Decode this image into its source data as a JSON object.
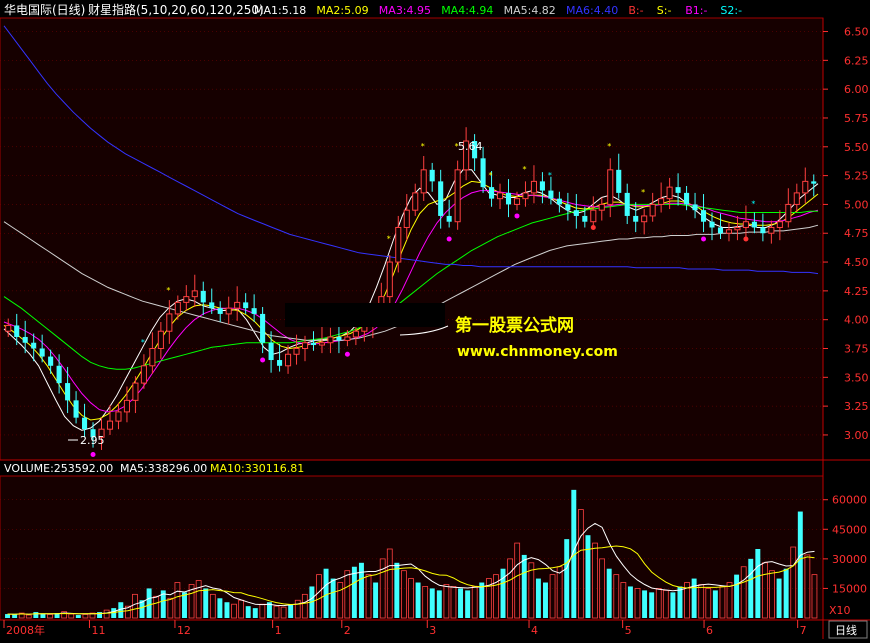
{
  "header": {
    "title": "华电国际(日线)",
    "indicator": "财星指路(5,10,20,60,120,250)",
    "ma_items": [
      {
        "label": "MA1:5.18",
        "color": "#ffffff"
      },
      {
        "label": "MA2:5.09",
        "color": "#ffff00"
      },
      {
        "label": "MA3:4.95",
        "color": "#ff00ff"
      },
      {
        "label": "MA4:4.94",
        "color": "#00ff00"
      },
      {
        "label": "MA5:4.82",
        "color": "#d0d0d0"
      },
      {
        "label": "MA6:4.40",
        "color": "#3333ff"
      },
      {
        "label": "B:-",
        "color": "#ff3333"
      },
      {
        "label": "S:-",
        "color": "#ffff00"
      },
      {
        "label": "B1:-",
        "color": "#ff00ff"
      },
      {
        "label": "S2:-",
        "color": "#00ffff"
      }
    ]
  },
  "volume_header": {
    "volume": "VOLUME:253592.00",
    "ma5": "MA5:338296.00",
    "ma10": "MA10:330116.81"
  },
  "watermark": {
    "title": "第一股票公式网",
    "url": "www.chnmoney.com"
  },
  "price_annotations": {
    "high": "5.64",
    "low": "2.95"
  },
  "x_axis": {
    "labels": [
      "2008年",
      "11",
      "12",
      "1",
      "2",
      "3",
      "4",
      "5",
      "6",
      "7"
    ],
    "period_button": "日线"
  },
  "volume_unit": "X10",
  "colors": {
    "background": "#000000",
    "panel_bg": "#1a0000",
    "grid": "#800000",
    "up": "#ff4040",
    "down": "#40ffff",
    "axis_text": "#ff3030"
  },
  "chart_data": [
    {
      "type": "candlestick",
      "title": "华电国际(日线)",
      "ylim": [
        2.8,
        6.6
      ],
      "yticks": [
        3.0,
        3.25,
        3.5,
        3.75,
        4.0,
        4.25,
        4.5,
        4.75,
        5.0,
        5.25,
        5.5,
        5.75,
        6.0,
        6.25,
        6.5
      ],
      "ytick_labels": [
        "3.00",
        "3.25",
        "3.50",
        "3.75",
        "4.00",
        "4.25",
        "4.50",
        "4.75",
        "5.00",
        "5.25",
        "5.50",
        "5.75",
        "6.00",
        "6.25",
        "6.50"
      ],
      "month_labels": [
        "2008年",
        "11",
        "12",
        "1",
        "2",
        "3",
        "4",
        "5",
        "6",
        "7"
      ],
      "high": 5.64,
      "low": 2.95,
      "close_path": [
        3.95,
        3.85,
        3.8,
        3.75,
        3.68,
        3.6,
        3.45,
        3.3,
        3.15,
        3.05,
        2.98,
        3.05,
        3.12,
        3.2,
        3.3,
        3.45,
        3.6,
        3.75,
        3.9,
        4.05,
        4.15,
        4.2,
        4.25,
        4.15,
        4.1,
        4.05,
        4.1,
        4.15,
        4.1,
        4.05,
        3.8,
        3.65,
        3.6,
        3.7,
        3.75,
        3.8,
        3.78,
        3.8,
        3.85,
        3.82,
        3.85,
        3.9,
        3.95,
        4.0,
        4.2,
        4.5,
        4.8,
        4.95,
        5.1,
        5.3,
        5.2,
        4.9,
        4.85,
        5.3,
        5.55,
        5.4,
        5.15,
        5.05,
        5.1,
        5.0,
        5.05,
        5.1,
        5.2,
        5.12,
        5.05,
        5.0,
        4.95,
        4.9,
        4.85,
        4.95,
        5.0,
        5.3,
        5.1,
        4.9,
        4.85,
        4.9,
        5.0,
        5.05,
        5.15,
        5.1,
        5.0,
        4.95,
        4.85,
        4.8,
        4.75,
        4.78,
        4.8,
        4.85,
        4.8,
        4.75,
        4.8,
        4.85,
        5.0,
        5.1,
        5.2,
        5.18
      ],
      "series": [
        {
          "name": "MA1",
          "values": [
            3.92,
            3.85,
            3.78,
            3.7,
            3.6,
            3.45,
            3.3,
            3.16,
            3.08,
            3.04,
            3.06,
            3.12,
            3.22,
            3.34,
            3.48,
            3.62,
            3.76,
            3.9,
            4.02,
            4.1,
            4.16,
            4.18,
            4.16,
            4.12,
            4.1,
            4.08,
            4.08,
            4.09,
            4.0,
            3.88,
            3.76,
            3.7,
            3.72,
            3.76,
            3.79,
            3.8,
            3.82,
            3.83,
            3.84,
            3.86,
            3.9,
            3.98,
            4.1,
            4.28,
            4.48,
            4.7,
            4.9,
            5.06,
            5.14,
            5.1,
            5.0,
            5.04,
            5.2,
            5.3,
            5.3,
            5.2,
            5.1,
            5.08,
            5.06,
            5.06,
            5.1,
            5.12,
            5.1,
            5.06,
            5.0,
            4.95,
            4.92,
            4.94,
            5.0,
            5.06,
            5.08,
            5.04,
            4.98,
            4.95,
            4.98,
            5.02,
            5.06,
            5.08,
            5.06,
            5.0,
            4.94,
            4.88,
            4.83,
            4.8,
            4.8,
            4.81,
            4.82,
            4.8,
            4.8,
            4.83,
            4.9,
            4.98,
            5.06,
            5.12,
            5.18
          ]
        },
        {
          "name": "MA2",
          "values": [
            3.95,
            3.9,
            3.84,
            3.78,
            3.7,
            3.6,
            3.48,
            3.36,
            3.25,
            3.17,
            3.13,
            3.14,
            3.18,
            3.25,
            3.34,
            3.45,
            3.57,
            3.7,
            3.82,
            3.93,
            4.02,
            4.08,
            4.12,
            4.13,
            4.12,
            4.1,
            4.09,
            4.08,
            4.04,
            3.98,
            3.9,
            3.82,
            3.77,
            3.75,
            3.76,
            3.78,
            3.8,
            3.82,
            3.84,
            3.86,
            3.88,
            3.92,
            3.98,
            4.08,
            4.22,
            4.4,
            4.6,
            4.78,
            4.92,
            5.0,
            5.03,
            5.05,
            5.1,
            5.16,
            5.2,
            5.19,
            5.15,
            5.11,
            5.08,
            5.07,
            5.07,
            5.08,
            5.08,
            5.06,
            5.03,
            5.0,
            4.97,
            4.96,
            4.97,
            5.0,
            5.02,
            5.02,
            5.0,
            4.98,
            4.98,
            4.99,
            5.01,
            5.03,
            5.03,
            5.01,
            4.98,
            4.93,
            4.89,
            4.86,
            4.84,
            4.83,
            4.83,
            4.82,
            4.82,
            4.83,
            4.86,
            4.91,
            4.97,
            5.03,
            5.09
          ]
        },
        {
          "name": "MA3",
          "values": [
            3.98,
            3.95,
            3.92,
            3.88,
            3.83,
            3.76,
            3.67,
            3.57,
            3.46,
            3.36,
            3.28,
            3.22,
            3.2,
            3.21,
            3.25,
            3.32,
            3.41,
            3.52,
            3.63,
            3.74,
            3.84,
            3.93,
            4.0,
            4.05,
            4.08,
            4.1,
            4.1,
            4.1,
            4.08,
            4.05,
            4.0,
            3.94,
            3.88,
            3.83,
            3.8,
            3.79,
            3.79,
            3.8,
            3.81,
            3.82,
            3.83,
            3.85,
            3.88,
            3.93,
            4.01,
            4.12,
            4.26,
            4.42,
            4.58,
            4.72,
            4.84,
            4.93,
            5.0,
            5.06,
            5.1,
            5.12,
            5.12,
            5.11,
            5.1,
            5.09,
            5.08,
            5.08,
            5.07,
            5.06,
            5.04,
            5.02,
            5.0,
            4.99,
            4.98,
            4.98,
            4.99,
            5.0,
            5.0,
            4.99,
            4.99,
            4.99,
            5.0,
            5.01,
            5.01,
            5.0,
            4.99,
            4.97,
            4.94,
            4.92,
            4.9,
            4.88,
            4.87,
            4.86,
            4.85,
            4.85,
            4.86,
            4.88,
            4.9,
            4.93,
            4.95
          ]
        },
        {
          "name": "MA4",
          "values": [
            4.2,
            4.15,
            4.1,
            4.04,
            3.98,
            3.92,
            3.86,
            3.8,
            3.74,
            3.68,
            3.63,
            3.6,
            3.58,
            3.57,
            3.57,
            3.58,
            3.6,
            3.62,
            3.64,
            3.66,
            3.68,
            3.7,
            3.72,
            3.74,
            3.76,
            3.77,
            3.78,
            3.79,
            3.8,
            3.8,
            3.8,
            3.8,
            3.8,
            3.8,
            3.81,
            3.82,
            3.83,
            3.84,
            3.86,
            3.88,
            3.9,
            3.93,
            3.96,
            4.0,
            4.05,
            4.1,
            4.16,
            4.22,
            4.28,
            4.34,
            4.4,
            4.45,
            4.5,
            4.55,
            4.6,
            4.64,
            4.68,
            4.72,
            4.75,
            4.78,
            4.81,
            4.84,
            4.86,
            4.88,
            4.9,
            4.92,
            4.94,
            4.95,
            4.96,
            4.97,
            4.98,
            4.99,
            5.0,
            5.0,
            5.0,
            5.0,
            5.0,
            5.0,
            5.0,
            4.99,
            4.98,
            4.97,
            4.96,
            4.95,
            4.94,
            4.93,
            4.93,
            4.93,
            4.93,
            4.93,
            4.93,
            4.93,
            4.93,
            4.94,
            4.94
          ]
        },
        {
          "name": "MA5",
          "values": [
            4.85,
            4.8,
            4.75,
            4.7,
            4.65,
            4.6,
            4.55,
            4.5,
            4.45,
            4.4,
            4.36,
            4.32,
            4.28,
            4.25,
            4.22,
            4.19,
            4.16,
            4.14,
            4.12,
            4.1,
            4.08,
            4.06,
            4.04,
            4.02,
            4.0,
            3.98,
            3.96,
            3.94,
            3.92,
            3.9,
            3.88,
            3.86,
            3.85,
            3.84,
            3.83,
            3.82,
            3.82,
            3.82,
            3.82,
            3.82,
            3.83,
            3.84,
            3.86,
            3.88,
            3.9,
            3.93,
            3.96,
            4.0,
            4.04,
            4.08,
            4.12,
            4.16,
            4.2,
            4.24,
            4.28,
            4.32,
            4.36,
            4.4,
            4.44,
            4.48,
            4.51,
            4.54,
            4.57,
            4.6,
            4.62,
            4.64,
            4.65,
            4.66,
            4.67,
            4.68,
            4.69,
            4.7,
            4.7,
            4.71,
            4.71,
            4.72,
            4.72,
            4.73,
            4.73,
            4.73,
            4.74,
            4.74,
            4.74,
            4.75,
            4.75,
            4.75,
            4.76,
            4.76,
            4.76,
            4.77,
            4.77,
            4.78,
            4.79,
            4.8,
            4.82
          ]
        },
        {
          "name": "MA6",
          "values": [
            6.55,
            6.45,
            6.35,
            6.25,
            6.15,
            6.05,
            5.96,
            5.88,
            5.8,
            5.73,
            5.66,
            5.6,
            5.54,
            5.49,
            5.44,
            5.4,
            5.36,
            5.32,
            5.28,
            5.24,
            5.2,
            5.16,
            5.12,
            5.08,
            5.04,
            5.0,
            4.96,
            4.92,
            4.89,
            4.86,
            4.83,
            4.8,
            4.77,
            4.74,
            4.72,
            4.7,
            4.68,
            4.66,
            4.64,
            4.62,
            4.6,
            4.58,
            4.57,
            4.56,
            4.55,
            4.54,
            4.53,
            4.52,
            4.51,
            4.5,
            4.49,
            4.48,
            4.48,
            4.47,
            4.47,
            4.46,
            4.46,
            4.46,
            4.46,
            4.46,
            4.46,
            4.46,
            4.46,
            4.46,
            4.46,
            4.46,
            4.46,
            4.46,
            4.46,
            4.46,
            4.46,
            4.46,
            4.46,
            4.45,
            4.45,
            4.45,
            4.45,
            4.45,
            4.45,
            4.44,
            4.44,
            4.44,
            4.44,
            4.43,
            4.43,
            4.43,
            4.43,
            4.42,
            4.42,
            4.42,
            4.42,
            4.41,
            4.41,
            4.41,
            4.4
          ]
        }
      ]
    },
    {
      "type": "bar",
      "title": "VOLUME",
      "ylim": [
        0,
        70000
      ],
      "yticks": [
        15000,
        30000,
        45000,
        60000
      ],
      "ytick_labels": [
        "15000",
        "30000",
        "45000",
        "60000"
      ],
      "unit": "X10",
      "values": [
        2000,
        1800,
        2500,
        1500,
        3000,
        2200,
        1800,
        2500,
        3200,
        2000,
        1500,
        1800,
        2500,
        3000,
        4000,
        5000,
        8000,
        6000,
        12000,
        9000,
        15000,
        11000,
        14000,
        10000,
        18000,
        13000,
        17000,
        19000,
        15000,
        12000,
        10000,
        8000,
        7000,
        9000,
        6000,
        5000,
        7000,
        8000,
        6000,
        5500,
        7000,
        9000,
        12000,
        16000,
        22000,
        25000,
        20000,
        18000,
        24000,
        26000,
        28000,
        22000,
        18000,
        30000,
        35000,
        28000,
        24000,
        20000,
        18000,
        16000,
        15000,
        14000,
        17000,
        16000,
        15000,
        14000,
        16000,
        18000,
        20000,
        22000,
        25000,
        30000,
        38000,
        32000,
        28000,
        20000,
        18000,
        22000,
        26000,
        40000,
        65000,
        55000,
        42000,
        38000,
        30000,
        25000,
        22000,
        18000,
        16000,
        15000,
        14000,
        13000,
        15000,
        14000,
        13000,
        16000,
        18000,
        20000,
        17000,
        15000,
        14000,
        16000,
        18000,
        22000,
        26000,
        30000,
        35000,
        28000,
        24000,
        20000,
        25000,
        36000,
        54000,
        32000,
        22000
      ]
    }
  ]
}
